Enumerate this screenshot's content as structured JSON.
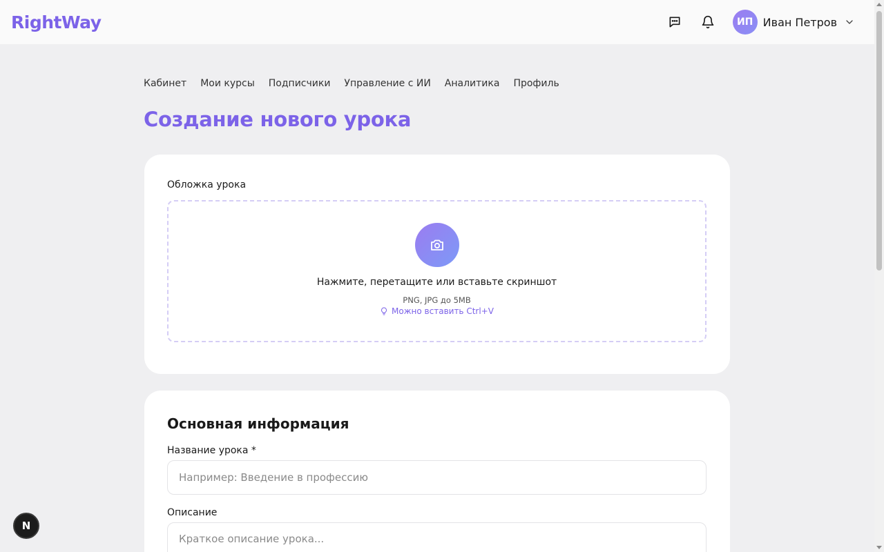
{
  "header": {
    "logo": "RightWay",
    "user": {
      "initials": "ИП",
      "name": "Иван Петров"
    }
  },
  "nav": {
    "items": [
      "Кабинет",
      "Мои курсы",
      "Подписчики",
      "Управление с ИИ",
      "Аналитика",
      "Профиль"
    ]
  },
  "page": {
    "title": "Создание нового урока"
  },
  "cover": {
    "label": "Обложка урока",
    "dropzone_text": "Нажмите, перетащите или вставьте скриншот",
    "formats": "PNG, JPG до 5MB",
    "hint": "Можно вставить Ctrl+V"
  },
  "basic_info": {
    "title": "Основная информация",
    "name_label": "Название урока *",
    "name_placeholder": "Например: Введение в профессию",
    "description_label": "Описание",
    "description_placeholder": "Краткое описание урока..."
  },
  "dev_badge": {
    "letter": "N"
  },
  "colors": {
    "accent": "#7c63e8",
    "background": "#efeff1"
  }
}
